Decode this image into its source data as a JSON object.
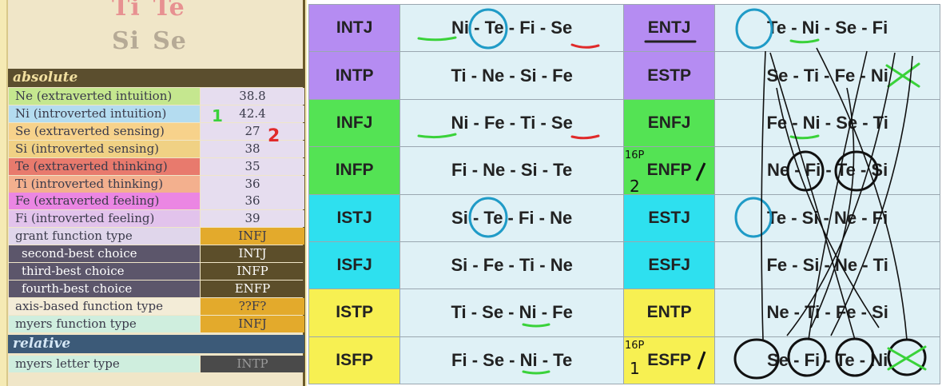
{
  "logo": {
    "row1": [
      "Ti",
      "Te"
    ],
    "row2": [
      "Si",
      "Se"
    ]
  },
  "absolute": {
    "header": "absolute",
    "rows": [
      {
        "label": "Ne (extraverted intuition)",
        "value": "38.8",
        "color": "#c5e78f"
      },
      {
        "label": "Ni (introverted intuition)",
        "value": "42.4",
        "color": "#b4dcf0"
      },
      {
        "label": "Se (extraverted sensing)",
        "value": "27",
        "color": "#f7d28b"
      },
      {
        "label": "Si (introverted sensing)",
        "value": "38",
        "color": "#f0d184"
      },
      {
        "label": "Te (extraverted thinking)",
        "value": "35",
        "color": "#e87a6d"
      },
      {
        "label": "Ti (introverted thinking)",
        "value": "36",
        "color": "#f3b08e"
      },
      {
        "label": "Fe (extraverted feeling)",
        "value": "36",
        "color": "#eb86e3"
      },
      {
        "label": "Fi (introverted feeling)",
        "value": "39",
        "color": "#e2c3ec"
      },
      {
        "label": "grant function type",
        "value": "INFJ",
        "color": "#e0d6eb",
        "valcolor": "#e3aa2c"
      },
      {
        "label": "second-best choice",
        "value": "INTJ",
        "color": "#5c566b",
        "valcolor": "#5c4e2a",
        "sub": true
      },
      {
        "label": "third-best choice",
        "value": "INFP",
        "color": "#5c566b",
        "valcolor": "#5c4e2a",
        "sub": true
      },
      {
        "label": "fourth-best choice",
        "value": "ENFP",
        "color": "#5c566b",
        "valcolor": "#5c4e2a",
        "sub": true
      },
      {
        "label": "axis-based function type",
        "value": "??F?",
        "color": "#f3ecd7",
        "valcolor": "#e3aa2c"
      },
      {
        "label": "myers function type",
        "value": "INFJ",
        "color": "#cfeede",
        "valcolor": "#e3aa2c"
      }
    ]
  },
  "relative": {
    "header": "relative",
    "rows": [
      {
        "label": "myers letter type",
        "value": "INTP",
        "color": "#cfeede",
        "valcolor": "#4a4a4a"
      }
    ]
  },
  "table": {
    "rows": [
      {
        "t1": "INTJ",
        "f1": "Ni - Te - Fi - Se",
        "c1": "#b58cf2",
        "t2": "ENTJ",
        "f2": "Te - Ni - Se - Fi",
        "c2": "#b58cf2"
      },
      {
        "t1": "INTP",
        "f1": "Ti - Ne - Si - Fe",
        "c1": "#b58cf2",
        "t2": "ESTP",
        "f2": "Se - Ti - Fe - Ni",
        "c2": "#b58cf2"
      },
      {
        "t1": "INFJ",
        "f1": "Ni - Fe - Ti - Se",
        "c1": "#54e354",
        "t2": "ENFJ",
        "f2": "Fe - Ni - Se - Ti",
        "c2": "#54e354"
      },
      {
        "t1": "INFP",
        "f1": "Fi - Ne - Si - Te",
        "c1": "#54e354",
        "t2": "ENFP",
        "f2": "Ne - Fi - Te - Si",
        "c2": "#54e354"
      },
      {
        "t1": "ISTJ",
        "f1": "Si - Te - Fi - Ne",
        "c1": "#2ee0ef",
        "t2": "ESTJ",
        "f2": "Te - Si - Ne - Fi",
        "c2": "#2ee0ef"
      },
      {
        "t1": "ISFJ",
        "f1": "Si - Fe - Ti - Ne",
        "c1": "#2ee0ef",
        "t2": "ESFJ",
        "f2": "Fe - Si - Ne - Ti",
        "c2": "#2ee0ef"
      },
      {
        "t1": "ISTP",
        "f1": "Ti - Se - Ni - Fe",
        "c1": "#f7f052",
        "t2": "ENTP",
        "f2": "Ne - Ti - Fe - Si",
        "c2": "#f7f052"
      },
      {
        "t1": "ISFP",
        "f1": "Fi - Se - Ni - Te",
        "c1": "#f7f052",
        "t2": "ESFP",
        "f2": "Se - Fi - Te - Ni",
        "c2": "#f7f052"
      }
    ]
  },
  "annotations": {
    "num1": "1",
    "num2": "2",
    "enfp_mark": "16P",
    "enfp_num": "2",
    "esfp_mark": "16P",
    "esfp_num": "1"
  }
}
